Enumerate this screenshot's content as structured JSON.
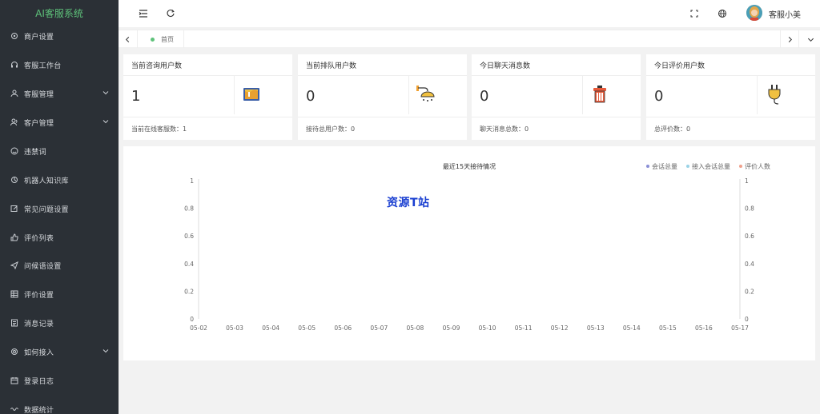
{
  "sidebar": {
    "title": "AI客服系统",
    "items": [
      {
        "label": "商户设置",
        "icon": "gear-icon",
        "has_arrow": false
      },
      {
        "label": "客服工作台",
        "icon": "headset-icon",
        "has_arrow": false
      },
      {
        "label": "客服管理",
        "icon": "user-icon",
        "has_arrow": true
      },
      {
        "label": "客户管理",
        "icon": "users-icon",
        "has_arrow": true
      },
      {
        "label": "违禁词",
        "icon": "smile-icon",
        "has_arrow": false
      },
      {
        "label": "机器人知识库",
        "icon": "robot-icon",
        "has_arrow": false
      },
      {
        "label": "常见问题设置",
        "icon": "edit-icon",
        "has_arrow": false
      },
      {
        "label": "评价列表",
        "icon": "thumb-up-icon",
        "has_arrow": false
      },
      {
        "label": "问候语设置",
        "icon": "send-icon",
        "has_arrow": false
      },
      {
        "label": "评价设置",
        "icon": "grid-icon",
        "has_arrow": false
      },
      {
        "label": "消息记录",
        "icon": "list-icon",
        "has_arrow": false
      },
      {
        "label": "如何接入",
        "icon": "settings-icon",
        "has_arrow": true
      },
      {
        "label": "登录日志",
        "icon": "calendar-icon",
        "has_arrow": false
      },
      {
        "label": "数据统计",
        "icon": "wave-icon",
        "has_arrow": false
      }
    ]
  },
  "header": {
    "username": "客服小美",
    "icons": [
      "menu-fold-icon",
      "refresh-icon",
      "fullscreen-icon",
      "globe-icon"
    ]
  },
  "tabs": {
    "home_label": "首页"
  },
  "cards": [
    {
      "title": "当前咨询用户数",
      "value": "1",
      "footer": "当前在线客服数：1",
      "icon": "paint-bucket-icon"
    },
    {
      "title": "当前排队用户数",
      "value": "0",
      "footer": "接待总用户数：0",
      "icon": "shower-icon"
    },
    {
      "title": "今日聊天消息数",
      "value": "0",
      "footer": "聊天消息总数：0",
      "icon": "trash-icon"
    },
    {
      "title": "今日评价用户数",
      "value": "0",
      "footer": "总评价数：0",
      "icon": "plug-icon"
    }
  ],
  "watermark": "资源T站",
  "colors": {
    "sidebar_bg": "#2b3036",
    "accent_green": "#5ec27a",
    "series_1": "#8a8fd6",
    "series_2": "#9ad3e6",
    "series_3": "#f0a08c"
  },
  "chart_data": {
    "type": "line",
    "title": "最近15天接待情况",
    "categories": [
      "05-02",
      "05-03",
      "05-04",
      "05-05",
      "05-06",
      "05-07",
      "05-08",
      "05-09",
      "05-10",
      "05-11",
      "05-12",
      "05-13",
      "05-14",
      "05-15",
      "05-16",
      "05-17"
    ],
    "series": [
      {
        "name": "会话总量",
        "values": [
          0,
          0,
          0,
          0,
          0,
          0,
          0,
          0,
          0,
          0,
          0,
          0,
          0,
          0,
          0,
          0
        ]
      },
      {
        "name": "接入会话总量",
        "values": [
          0,
          0,
          0,
          0,
          0,
          0,
          0,
          0,
          0,
          0,
          0,
          0,
          0,
          0,
          0,
          0
        ]
      },
      {
        "name": "评价人数",
        "values": [
          0,
          0,
          0,
          0,
          0,
          0,
          0,
          0,
          0,
          0,
          0,
          0,
          0,
          0,
          0,
          0
        ]
      }
    ],
    "y_ticks": [
      "0",
      "0.2",
      "0.4",
      "0.6",
      "0.8",
      "1"
    ],
    "ylim": [
      0,
      1
    ],
    "legend_position": "top-right",
    "grid": false
  }
}
